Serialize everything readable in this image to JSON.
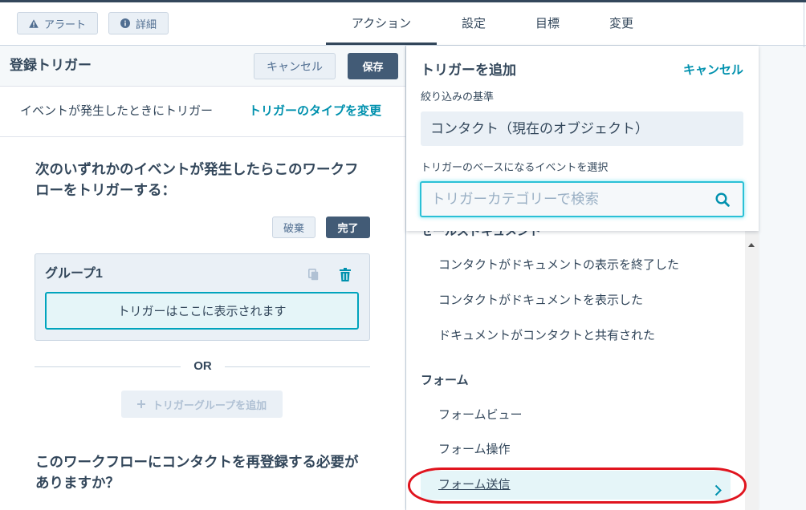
{
  "topbar": {
    "alert_label": "アラート",
    "details_label": "詳細",
    "tabs": [
      {
        "label": "アクション",
        "active": true
      },
      {
        "label": "設定",
        "active": false
      },
      {
        "label": "目標",
        "active": false
      },
      {
        "label": "変更",
        "active": false
      }
    ]
  },
  "enrollment_panel": {
    "title": "登録トリガー",
    "cancel_label": "キャンセル",
    "save_label": "保存",
    "trigger_type_text": "イベントが発生したときにトリガー",
    "change_type_link": "トリガーのタイプを変更",
    "criteria_heading": "次のいずれかのイベントが発生したらこのワークフローをトリガーする：",
    "discard_label": "破棄",
    "done_label": "完了",
    "group": {
      "title": "グループ1",
      "placeholder": "トリガーはここに表示されます"
    },
    "or_label": "OR",
    "add_group_label": "トリガーグループを追加",
    "reenroll_question": "このワークフローにコンタクトを再登録する必要がありますか？"
  },
  "add_trigger_panel": {
    "title": "トリガーを追加",
    "cancel_label": "キャンセル",
    "filter_label": "絞り込みの基準",
    "filter_value": "コンタクト（現在のオブジェクト）",
    "event_label": "トリガーのベースになるイベントを選択",
    "search_placeholder": "トリガーカテゴリーで検索",
    "categories": [
      {
        "name": "セールスドキュメント",
        "items": [
          {
            "label": "コンタクトがドキュメントの表示を終了した",
            "highlighted": false
          },
          {
            "label": "コンタクトがドキュメントを表示した",
            "highlighted": false
          },
          {
            "label": "ドキュメントがコンタクトと共有された",
            "highlighted": false
          }
        ]
      },
      {
        "name": "フォーム",
        "items": [
          {
            "label": "フォームビュー",
            "highlighted": false
          },
          {
            "label": "フォーム操作",
            "highlighted": false
          },
          {
            "label": "フォーム送信",
            "highlighted": true
          }
        ]
      }
    ]
  },
  "colors": {
    "text": "#33475b",
    "accent": "#0091ae",
    "primary_button": "#425b76",
    "secondary_button_bg": "#eaf0f6",
    "border": "#cbd6e2",
    "highlight_bg": "#e5f5f8",
    "disabled_text": "#b0c1d4",
    "annotation": "#e0141e"
  },
  "icons": {
    "alert": "warning-icon",
    "details": "info-icon",
    "copy_group": "copy-icon",
    "delete_group": "trash-icon",
    "add_group": "plus-icon",
    "search": "search-icon",
    "open_item": "chevron-right-icon",
    "scroll_up": "arrow-up-icon"
  }
}
